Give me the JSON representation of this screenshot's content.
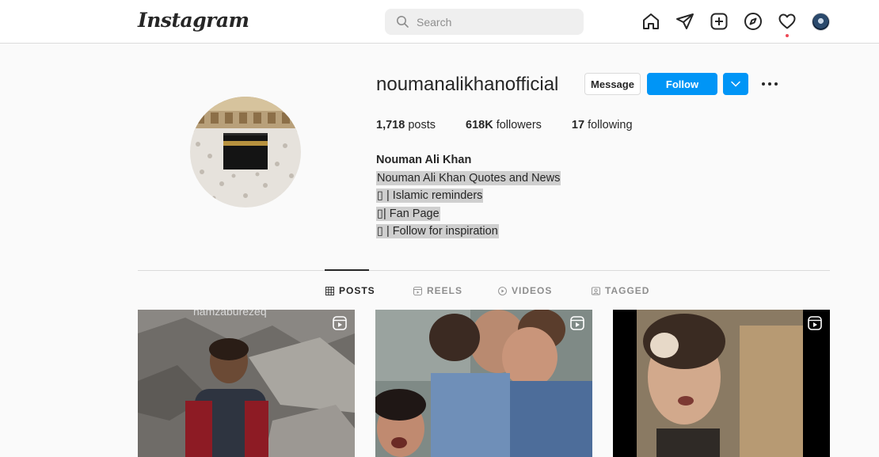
{
  "nav": {
    "logo": "Instagram",
    "search_placeholder": "Search",
    "icons": [
      "home-icon",
      "direct-icon",
      "new-post-icon",
      "explore-icon",
      "activity-icon",
      "profile-avatar"
    ]
  },
  "profile": {
    "username": "noumanalikhanofficial",
    "message_label": "Message",
    "follow_label": "Follow",
    "posts_count": "1,718",
    "posts_label": "posts",
    "followers_count": "618K",
    "followers_label": "followers",
    "following_count": "17",
    "following_label": "following",
    "full_name": "Nouman Ali Khan",
    "bio_lines": [
      "Nouman Ali Khan Quotes and News",
      "▯ | Islamic reminders",
      "▯| Fan Page",
      "▯ | Follow for inspiration"
    ]
  },
  "tabs": [
    {
      "label": "POSTS",
      "icon": "grid-icon",
      "active": true
    },
    {
      "label": "REELS",
      "icon": "reels-icon",
      "active": false
    },
    {
      "label": "VIDEOS",
      "icon": "video-icon",
      "active": false
    },
    {
      "label": "TAGGED",
      "icon": "tagged-icon",
      "active": false
    }
  ],
  "posts": [
    {
      "type": "reel",
      "overlay_text": "hamzaburezeq"
    },
    {
      "type": "reel"
    },
    {
      "type": "reel"
    }
  ],
  "colors": {
    "accent": "#0095f6",
    "text": "#262626",
    "muted": "#8e8e8e",
    "notification": "#ed4956"
  }
}
